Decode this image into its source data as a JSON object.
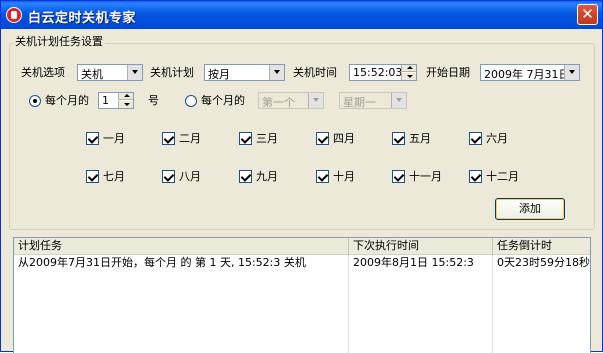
{
  "window": {
    "title": "白云定时关机专家",
    "close_glyph": "✕"
  },
  "group": {
    "title": "关机计划任务设置"
  },
  "row1": {
    "option_label": "关机选项",
    "option_value": "关机",
    "plan_label": "关机计划",
    "plan_value": "按月",
    "time_label": "关机时间",
    "time_value": "15:52:03",
    "date_label": "开始日期",
    "date_value": "2009年 7月31日"
  },
  "row2": {
    "radio1_label": "每个月的",
    "day_value": "1",
    "day_suffix": "号",
    "radio2_label": "每个月的",
    "week_ordinal": "第一个",
    "weekday": "星期一"
  },
  "months": [
    "一月",
    "二月",
    "三月",
    "四月",
    "五月",
    "六月",
    "七月",
    "八月",
    "九月",
    "十月",
    "十一月",
    "十二月"
  ],
  "add_button": "添加",
  "table": {
    "columns": [
      "计划任务",
      "下次执行时间",
      "任务倒计时"
    ],
    "rows": [
      [
        "从2009年7月31日开始，每个月 的 第 1 天, 15:52:3 关机",
        "2009年8月1日 15:52:3",
        "0天23时59分18秒"
      ]
    ]
  }
}
